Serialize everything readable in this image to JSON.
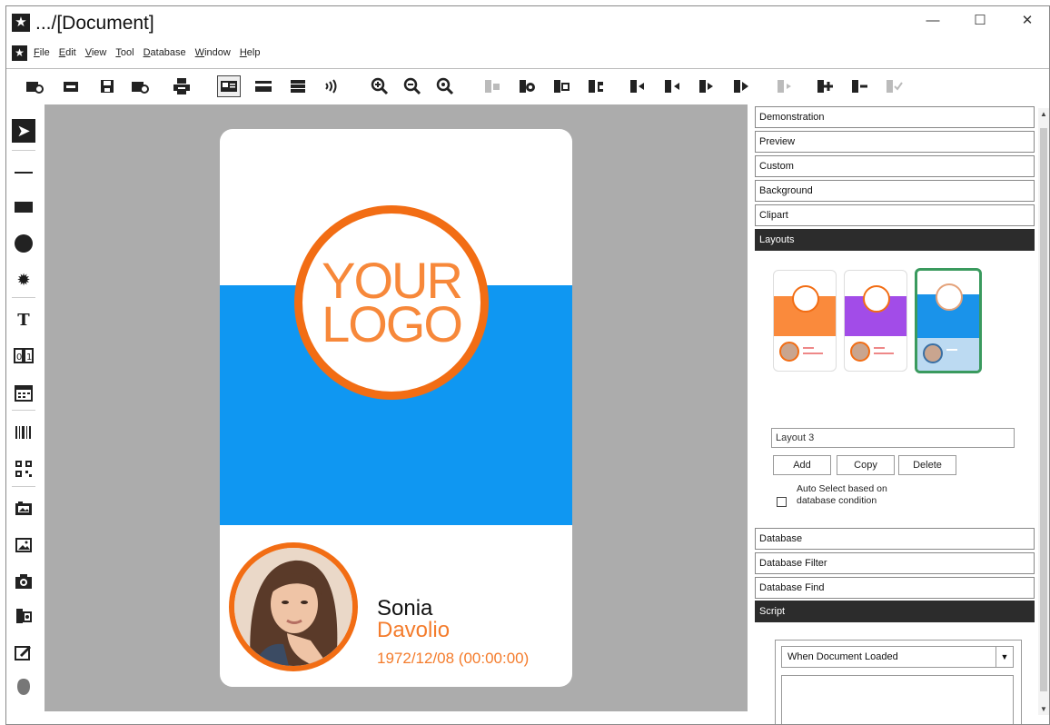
{
  "window": {
    "title": ".../[Document]",
    "minimize": "—",
    "maximize": "☐",
    "close": "✕"
  },
  "menu": [
    "File",
    "Edit",
    "View",
    "Tool",
    "Database",
    "Window",
    "Help"
  ],
  "card": {
    "logo_line1": "YOUR",
    "logo_line2": "LOGO",
    "first_name": "Sonia",
    "last_name": "Davolio",
    "dob": "1972/12/08 (00:00:00)",
    "colors": {
      "accent": "#f26d14",
      "band": "#0f97f2"
    }
  },
  "panel": {
    "sections_top": [
      "Demonstration",
      "Preview",
      "Custom",
      "Background",
      "Clipart",
      "Layouts"
    ],
    "layout_name": "Layout 3",
    "buttons": {
      "add": "Add",
      "copy": "Copy",
      "delete": "Delete"
    },
    "auto_select_label": "Auto Select based on database condition",
    "sections_bottom": [
      "Database",
      "Database Filter",
      "Database Find",
      "Script"
    ],
    "script_event": "When Document Loaded"
  },
  "layout_thumbnails": [
    {
      "color": "#fa8a3c",
      "selected": false
    },
    {
      "color": "#a24ce8",
      "selected": false
    },
    {
      "color": "#1a93ea",
      "selected": true
    }
  ]
}
